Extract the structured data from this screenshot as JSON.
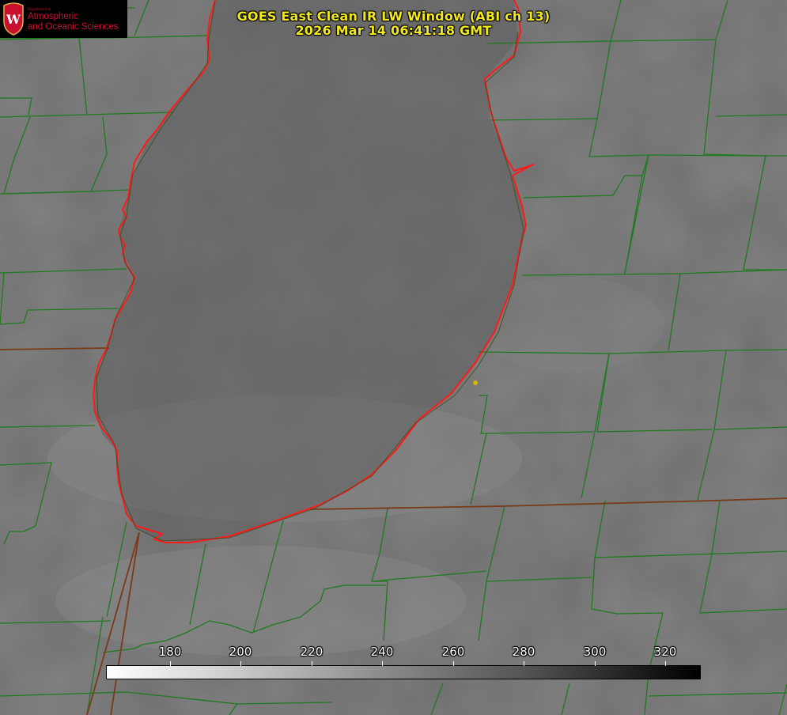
{
  "title": {
    "line1": "GOES East Clean IR LW Window (ABI ch 13)",
    "line2": "2026 Mar 14 06:41:18 GMT"
  },
  "logo": {
    "department": "Department of",
    "line1": "Atmospheric",
    "line2": "and Oceanic Sciences",
    "seal_letter": "W",
    "color": "#c8102e"
  },
  "colorbar": {
    "ticks": [
      "180",
      "200",
      "220",
      "240",
      "260",
      "280",
      "300",
      "320"
    ],
    "gradient": "white-to-black"
  },
  "map": {
    "lake_outline_color": "#ff1a1a",
    "boundary_color": "#1f7a1f",
    "marker_color": "#d4b400"
  }
}
